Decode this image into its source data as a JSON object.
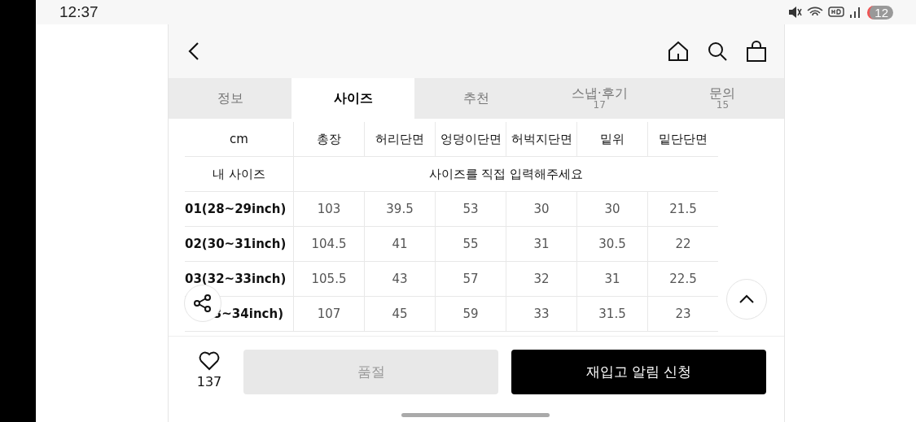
{
  "status_bar": {
    "time": "12:37",
    "battery": "12"
  },
  "tabs": [
    {
      "label": "정보",
      "selected": false
    },
    {
      "label": "사이즈",
      "selected": true
    },
    {
      "label": "추천",
      "selected": false
    },
    {
      "label": "스냅·후기",
      "count": "17",
      "selected": false
    },
    {
      "label": "문의",
      "count": "15",
      "selected": false
    }
  ],
  "size_table": {
    "columns": [
      "cm",
      "총장",
      "허리단면",
      "엉덩이단면",
      "허벅지단면",
      "밑위",
      "밑단단면"
    ],
    "my_size": {
      "label": "내 사이즈",
      "placeholder": "사이즈를 직접 입력해주세요"
    },
    "rows": [
      [
        "01(28~29inch)",
        "103",
        "39.5",
        "53",
        "30",
        "30",
        "21.5"
      ],
      [
        "02(30~31inch)",
        "104.5",
        "41",
        "55",
        "31",
        "30.5",
        "22"
      ],
      [
        "03(32~33inch)",
        "105.5",
        "43",
        "57",
        "32",
        "31",
        "22.5"
      ],
      [
        "3~34inch)",
        "107",
        "45",
        "59",
        "33",
        "31.5",
        "23"
      ]
    ]
  },
  "bottom_bar": {
    "likes": "137",
    "sold_out_button": {
      "label": "품절",
      "disabled": true
    },
    "restock_button": {
      "label": "재입고 알림 신청"
    }
  }
}
